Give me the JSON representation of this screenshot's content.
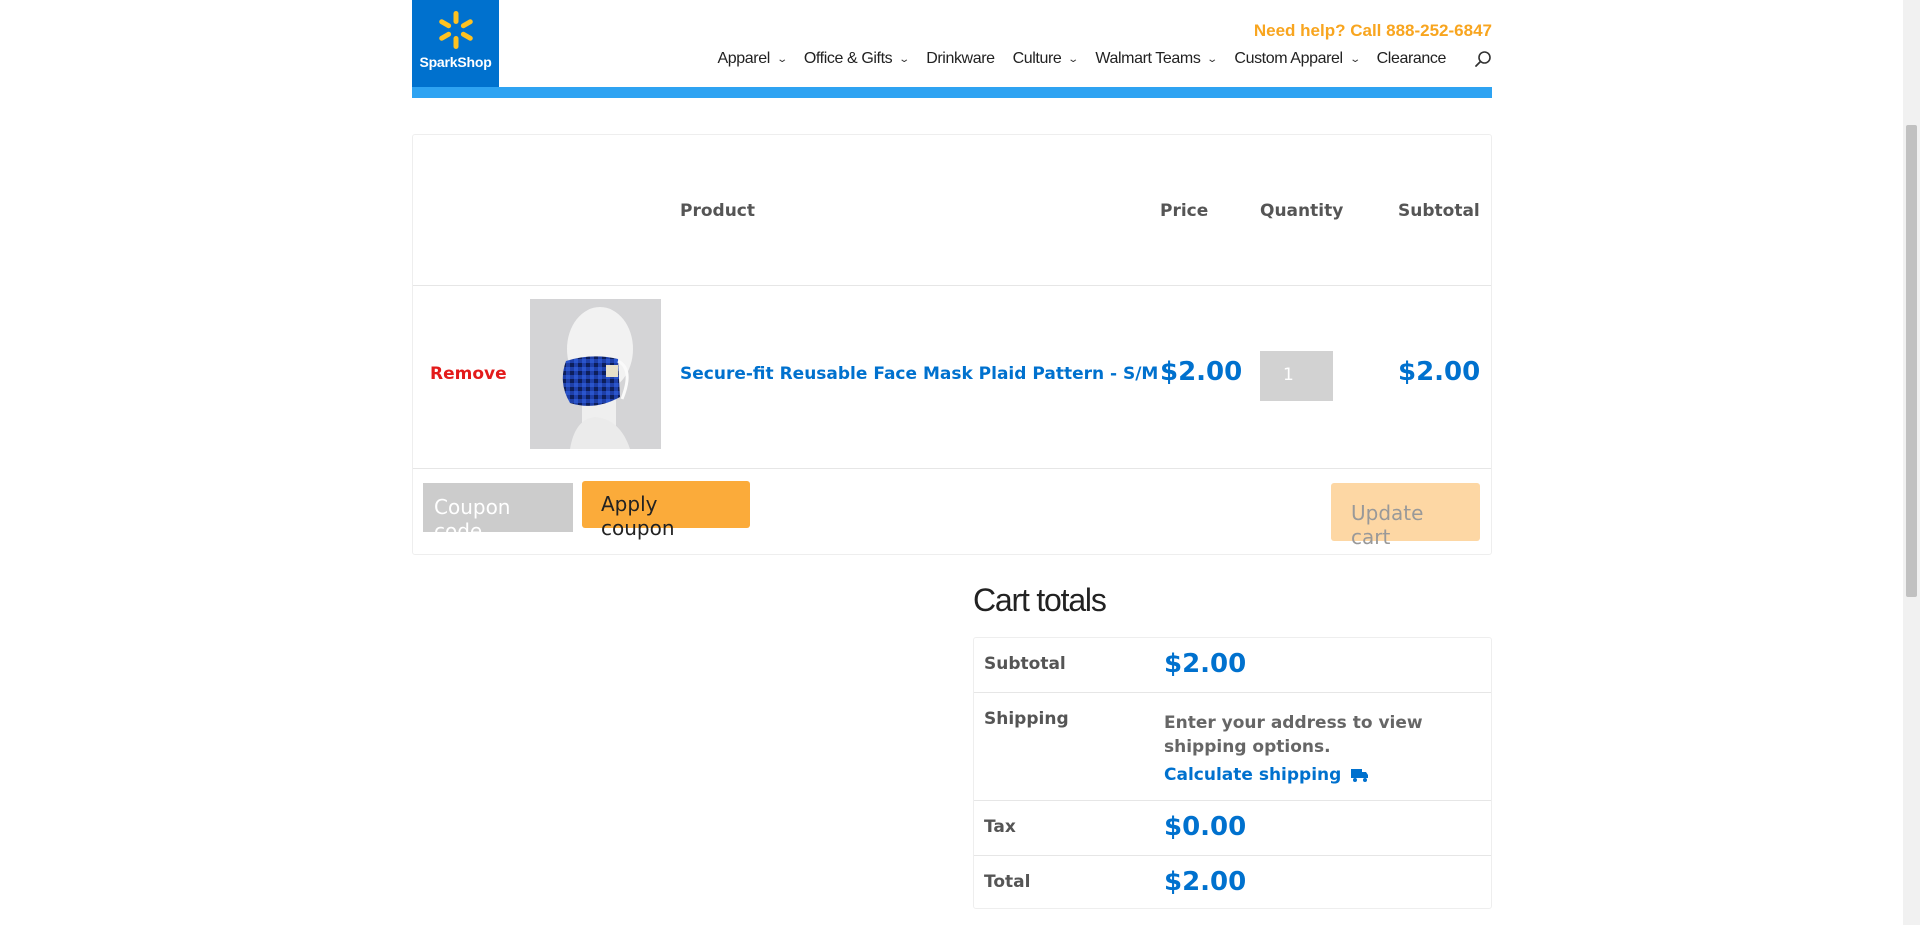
{
  "header": {
    "logo_text": "SparkShop",
    "help_text": "Need help? Call 888-252-6847",
    "nav": [
      {
        "label": "Apparel",
        "has_menu": true
      },
      {
        "label": "Office & Gifts",
        "has_menu": true
      },
      {
        "label": "Drinkware",
        "has_menu": false
      },
      {
        "label": "Culture",
        "has_menu": true
      },
      {
        "label": "Walmart Teams",
        "has_menu": true
      },
      {
        "label": "Custom Apparel",
        "has_menu": true
      },
      {
        "label": "Clearance",
        "has_menu": false
      }
    ],
    "search_icon": "search-icon"
  },
  "cart": {
    "columns": {
      "product": "Product",
      "price": "Price",
      "quantity": "Quantity",
      "subtotal": "Subtotal"
    },
    "items": [
      {
        "remove_label": "Remove",
        "name": "Secure-fit Reusable Face Mask Plaid Pattern - S/M",
        "price": "$2.00",
        "quantity": "1",
        "subtotal": "$2.00"
      }
    ],
    "coupon_placeholder": "Coupon code",
    "apply_label": "Apply coupon",
    "update_label": "Update cart"
  },
  "totals": {
    "title": "Cart totals",
    "subtotal_label": "Subtotal",
    "subtotal_value": "$2.00",
    "shipping_label": "Shipping",
    "shipping_text": "Enter your address to view shipping options.",
    "calculate_label": "Calculate shipping",
    "tax_label": "Tax",
    "tax_value": "$0.00",
    "total_label": "Total",
    "total_value": "$2.00"
  },
  "colors": {
    "brand_blue": "#0071ce",
    "accent_orange": "#fbab3a",
    "remove_red": "#e31b1b"
  }
}
